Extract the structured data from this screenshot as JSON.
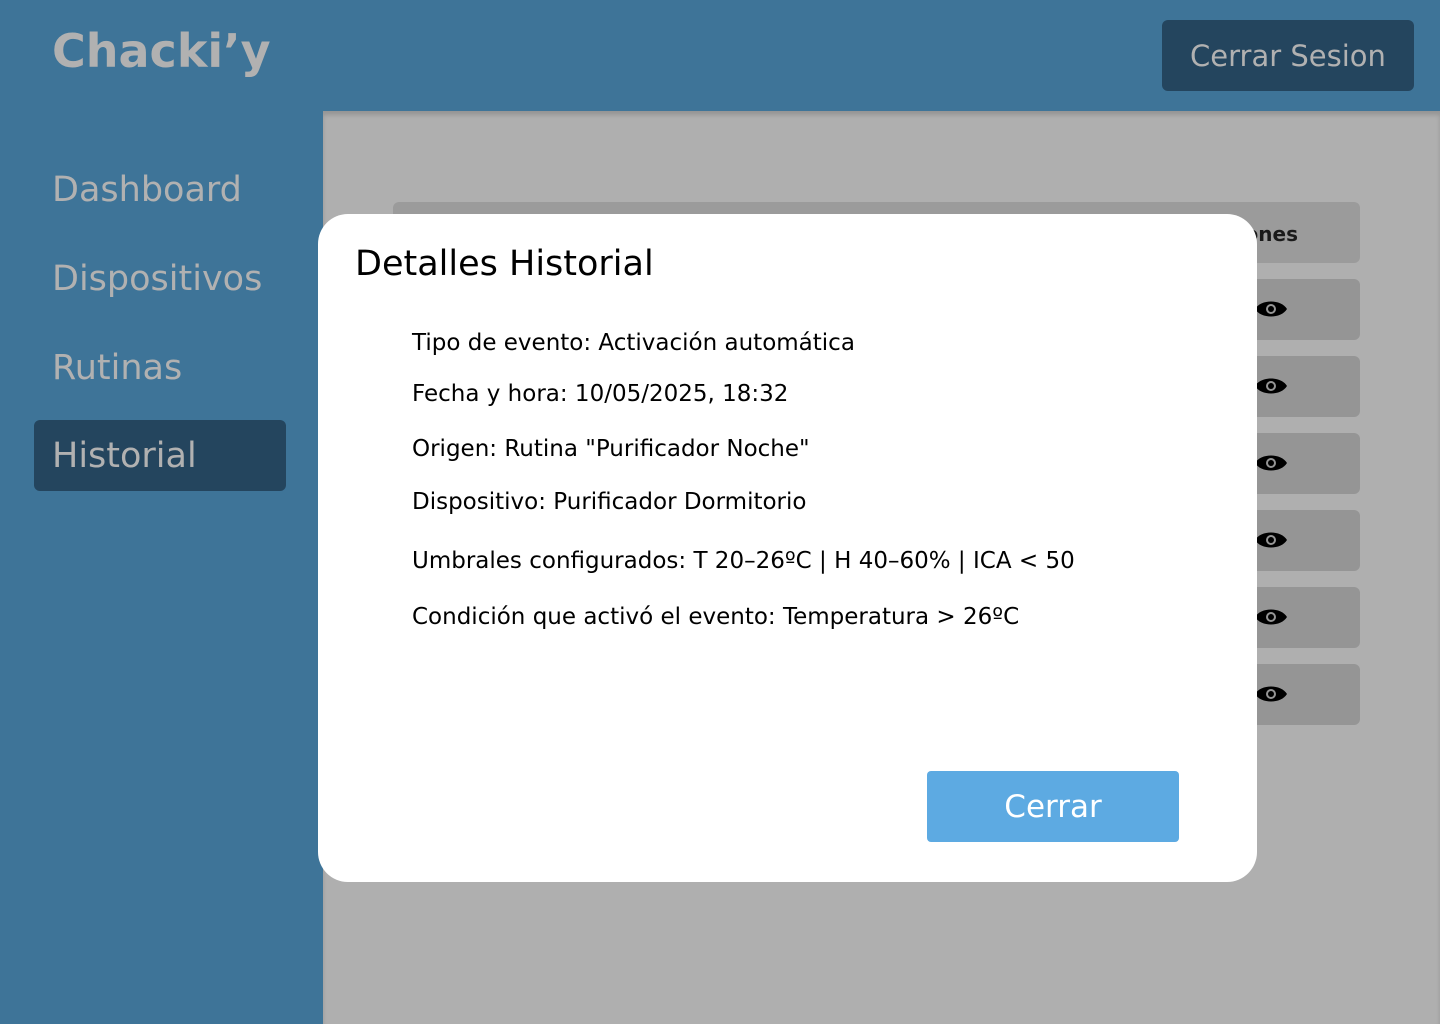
{
  "header": {
    "brand": "Chacki’y",
    "logout_label": "Cerrar Sesion"
  },
  "sidebar": {
    "items": [
      {
        "label": "Dashboard",
        "active": false
      },
      {
        "label": "Dispositivos",
        "active": false
      },
      {
        "label": "Rutinas",
        "active": false
      },
      {
        "label": "Historial",
        "active": true
      }
    ]
  },
  "table": {
    "header_visible_label": "ones",
    "row_count": 6,
    "row_action_icon": "eye-icon"
  },
  "modal": {
    "title": "Detalles Historial",
    "details": [
      "Tipo de evento: Activación automática",
      "Fecha y hora: 10/05/2025, 18:32",
      "Origen: Rutina \"Purificador Noche\"",
      "Dispositivo: Purificador Dormitorio",
      "Umbrales configurados: T 20–26ºC | H 40–60% | ICA < 50",
      "Condición que activó el evento: Temperatura > 26ºC"
    ],
    "close_label": "Cerrar"
  },
  "colors": {
    "primary": "#3e7498",
    "dark": "#24455e",
    "accent": "#5daae2",
    "overlay": "#afafaf"
  }
}
